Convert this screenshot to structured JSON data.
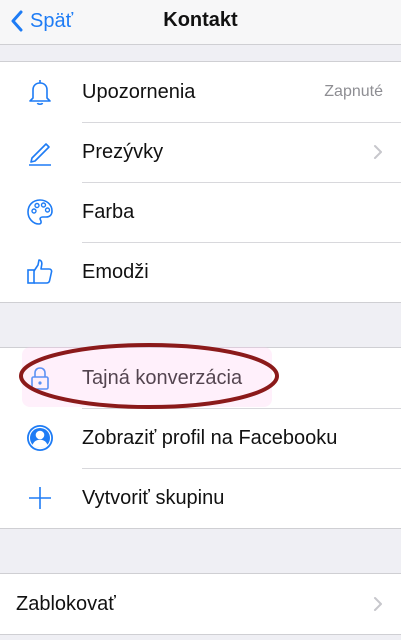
{
  "navbar": {
    "back_label": "Späť",
    "title": "Kontakt"
  },
  "group1": {
    "items": [
      {
        "label": "Upozornenia",
        "value": "Zapnuté",
        "icon": "bell-icon"
      },
      {
        "label": "Prezývky",
        "icon": "pencil-icon"
      },
      {
        "label": "Farba",
        "icon": "palette-icon"
      },
      {
        "label": "Emodži",
        "icon": "thumbs-up-icon"
      }
    ]
  },
  "group2": {
    "items": [
      {
        "label": "Tajná konverzácia",
        "icon": "lock-icon"
      },
      {
        "label": "Zobraziť profil na Facebooku",
        "icon": "profile-icon"
      },
      {
        "label": "Vytvoriť skupinu",
        "icon": "plus-icon"
      }
    ]
  },
  "group3": {
    "items": [
      {
        "label": "Zablokovať"
      }
    ]
  },
  "colors": {
    "accent": "#1e7cf5",
    "annotation": "#8b1a1a",
    "background": "#efeff4"
  }
}
